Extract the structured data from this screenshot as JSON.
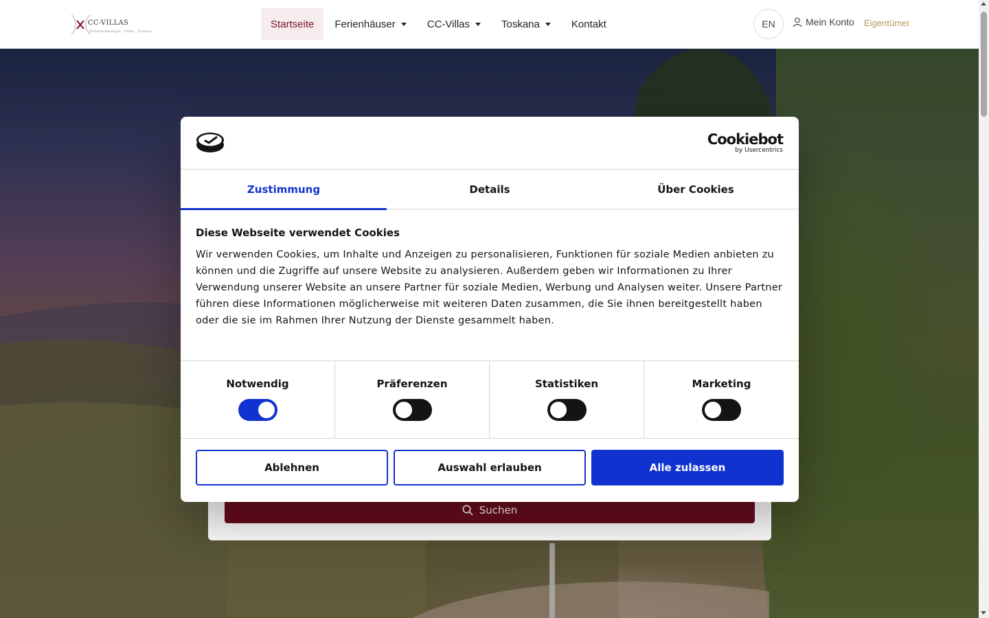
{
  "header": {
    "logo_text": "CC-VILLAS",
    "logo_sub": "Ferienwohnungen · Villen · Toskana",
    "nav": [
      {
        "label": "Startseite"
      },
      {
        "label": "Ferienhäuser"
      },
      {
        "label": "CC-Villas"
      },
      {
        "label": "Toskana"
      },
      {
        "label": "Kontakt"
      }
    ],
    "language": "EN",
    "account": "Mein Konto",
    "owner": "Eigentümer"
  },
  "search": {
    "button_label": "Suchen"
  },
  "cookie": {
    "brand": "Cookiebot",
    "brand_sub": "by Usercentrics",
    "tabs": [
      {
        "label": "Zustimmung"
      },
      {
        "label": "Details"
      },
      {
        "label": "Über Cookies"
      }
    ],
    "title": "Diese Webseite verwendet Cookies",
    "text": "Wir verwenden Cookies, um Inhalte und Anzeigen zu personalisieren, Funktionen für soziale Medien anbieten zu können und die Zugriffe auf unsere Website zu analysieren. Außerdem geben wir Informationen zu Ihrer Verwendung unserer Website an unsere Partner für soziale Medien, Werbung und Analysen weiter. Unsere Partner führen diese Informationen möglicherweise mit weiteren Daten zusammen, die Sie ihnen bereitgestellt haben oder die sie im Rahmen Ihrer Nutzung der Dienste gesammelt haben.",
    "toggles": [
      {
        "label": "Notwendig",
        "checked": true
      },
      {
        "label": "Präferenzen",
        "checked": false
      },
      {
        "label": "Statistiken",
        "checked": false
      },
      {
        "label": "Marketing",
        "checked": false
      }
    ],
    "buttons": {
      "decline": "Ablehnen",
      "allow_selection": "Auswahl erlauben",
      "allow_all": "Alle zulassen"
    }
  },
  "colors": {
    "accent": "#1032cf",
    "brand": "#6b0c1f",
    "owner_gold": "#b8985a"
  }
}
